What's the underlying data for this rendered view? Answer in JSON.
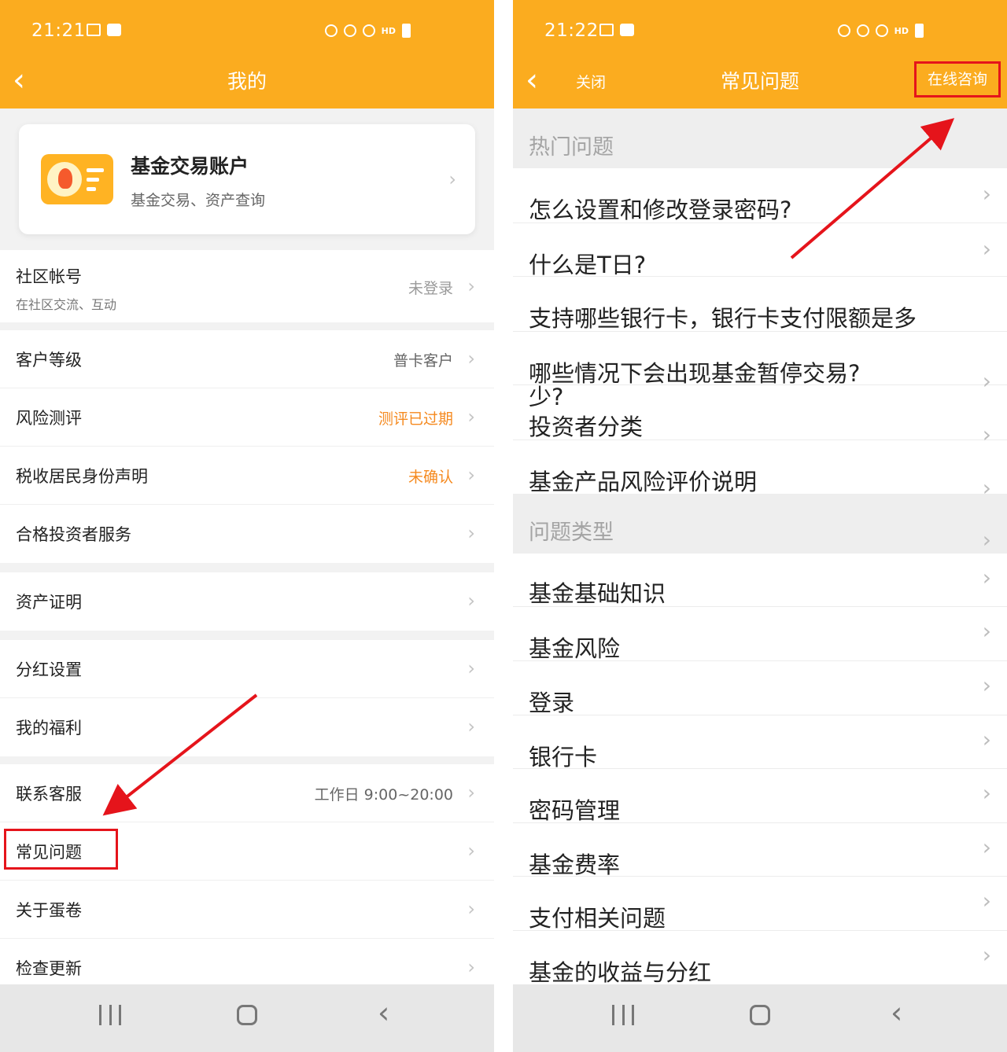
{
  "left": {
    "status": {
      "time": "21:21"
    },
    "nav": {
      "title": "我的",
      "back_icon": "chevron-left-icon"
    },
    "account_card": {
      "title": "基金交易账户",
      "subtitle": "基金交易、资产查询"
    },
    "community": {
      "label": "社区帐号",
      "sub": "在社区交流、互动",
      "value": "未登录"
    },
    "groups": [
      [
        {
          "label": "客户等级",
          "value": "普卡客户",
          "value_color": "gray"
        },
        {
          "label": "风险测评",
          "value": "测评已过期",
          "value_color": "orange"
        },
        {
          "label": "税收居民身份声明",
          "value": "未确认",
          "value_color": "orange"
        },
        {
          "label": "合格投资者服务",
          "value": ""
        }
      ],
      [
        {
          "label": "资产证明",
          "value": ""
        }
      ],
      [
        {
          "label": "分红设置",
          "value": ""
        },
        {
          "label": "我的福利",
          "value": ""
        }
      ],
      [
        {
          "label": "联系客服",
          "value": "工作日 9:00~20:00"
        },
        {
          "label": "常见问题",
          "value": ""
        },
        {
          "label": "关于蛋卷",
          "value": ""
        },
        {
          "label": "检查更新",
          "value": ""
        }
      ]
    ]
  },
  "right": {
    "status": {
      "time": "21:22"
    },
    "nav": {
      "close": "关闭",
      "title": "常见问题",
      "consult": "在线咨询"
    },
    "hot_header": "热门问题",
    "hot_items": [
      "怎么设置和修改登录密码?",
      "什么是T日?",
      "支持哪些银行卡，银行卡支付限额是多",
      "哪些情况下会出现基金暂停交易?",
      "投资者分类",
      "基金产品风险评价说明"
    ],
    "overflow_text": "少?",
    "type_header": "问题类型",
    "type_items": [
      "基金基础知识",
      "基金风险",
      "登录",
      "银行卡",
      "密码管理",
      "基金费率",
      "支付相关问题",
      "基金的收益与分红"
    ]
  },
  "colors": {
    "brand": "#fbac1f",
    "accent_orange": "#f5891e",
    "highlight_red": "#e5141b"
  }
}
